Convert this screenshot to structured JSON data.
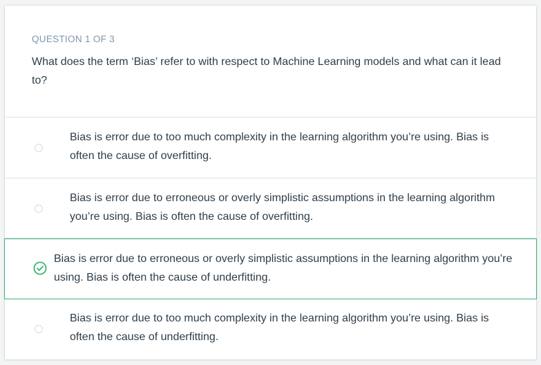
{
  "quiz": {
    "question_count": "QUESTION 1 OF 3",
    "question_text": "What does the term ‘Bias’ refer to with respect to Machine Learning models and what can it lead to?",
    "accent_color": "#3ab370",
    "selected_index": 2,
    "options": [
      {
        "label": "Bias is error due to too much complexity in the learning algorithm you’re using. Bias is often the cause of overfitting.",
        "selected": false
      },
      {
        "label": "Bias is error due to erroneous or overly simplistic assumptions in the learning algorithm you’re using. Bias is often the cause of overfitting.",
        "selected": false
      },
      {
        "label": "Bias is error due to erroneous or overly simplistic assumptions in the learning algorithm you’re using. Bias is often the cause of underfitting.",
        "selected": true
      },
      {
        "label": "Bias is error due to too much complexity in the learning algorithm you’re using. Bias is often the cause of underfitting.",
        "selected": false
      }
    ]
  }
}
